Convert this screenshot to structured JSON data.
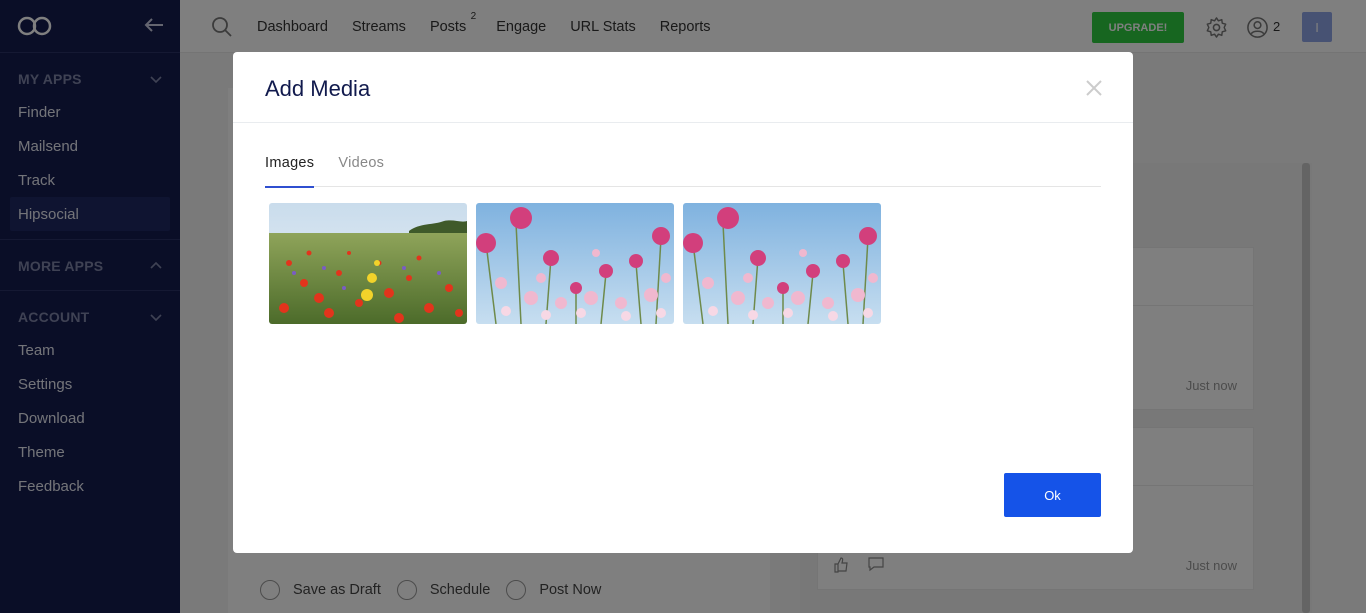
{
  "sidebar": {
    "sections": [
      {
        "title": "MY APPS",
        "items": [
          "Finder",
          "Mailsend",
          "Track",
          "Hipsocial"
        ],
        "active": "Hipsocial"
      },
      {
        "title": "MORE APPS",
        "items": []
      },
      {
        "title": "ACCOUNT",
        "items": [
          "Team",
          "Settings",
          "Download",
          "Theme",
          "Feedback"
        ]
      }
    ]
  },
  "topbar": {
    "nav": [
      "Dashboard",
      "Streams",
      "Posts",
      "Engage",
      "URL Stats",
      "Reports"
    ],
    "posts_badge": "2",
    "upgrade_label": "UPGRADE!",
    "user_count": "2",
    "avatar_initial": "I"
  },
  "background": {
    "time_1": "Just now",
    "time_2": "Just now",
    "radios": [
      "Save as Draft",
      "Schedule",
      "Post Now"
    ]
  },
  "modal": {
    "title": "Add Media",
    "tabs": [
      "Images",
      "Videos"
    ],
    "active_tab": "Images",
    "images": [
      "wildflower-meadow-image",
      "pink-flowers-sky-image",
      "pink-flowers-sky-image"
    ],
    "ok_label": "Ok"
  },
  "colors": {
    "sidebar_bg": "#151d4f",
    "accent_blue": "#1553e8",
    "upgrade_green": "#2ecc40",
    "overlay": "rgba(0,0,0,0.5)"
  }
}
